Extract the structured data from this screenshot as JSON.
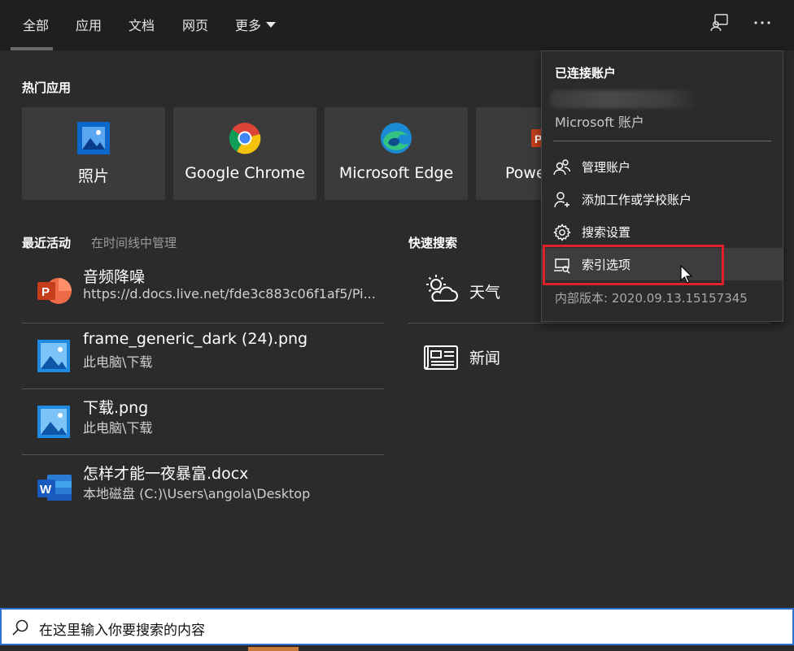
{
  "nav": {
    "tabs": [
      "全部",
      "应用",
      "文档",
      "网页",
      "更多"
    ],
    "active_tab": "全部"
  },
  "top_apps": {
    "title": "热门应用",
    "apps": [
      {
        "label": "照片",
        "icon": "photos-icon"
      },
      {
        "label": "Google Chrome",
        "icon": "chrome-icon"
      },
      {
        "label": "Microsoft Edge",
        "icon": "edge-icon"
      },
      {
        "label": "Powe",
        "icon": "powerpoint-icon"
      }
    ]
  },
  "recent": {
    "title": "最近活动",
    "manage_link": "在时间线中管理",
    "items": [
      {
        "title": "音频降噪",
        "subtitle": "https://d.docs.live.net/fde3c883c06f1af5/Pi...",
        "icon": "powerpoint-icon"
      },
      {
        "title": "frame_generic_dark (24).png",
        "subtitle": "此电脑\\下载",
        "icon": "image-file-icon"
      },
      {
        "title": "下载.png",
        "subtitle": "此电脑\\下载",
        "icon": "image-file-icon"
      },
      {
        "title": "怎样才能一夜暴富.docx",
        "subtitle": "本地磁盘 (C:)\\Users\\angola\\Desktop",
        "icon": "word-icon"
      }
    ]
  },
  "quick_search": {
    "title": "快速搜索",
    "items": [
      {
        "label": "天气",
        "icon": "weather-icon"
      },
      {
        "label": "新闻",
        "icon": "news-icon"
      }
    ]
  },
  "menu": {
    "title": "已连接账户",
    "account_type": "Microsoft 账户",
    "items": [
      {
        "label": "管理账户",
        "icon": "manage-accounts-icon"
      },
      {
        "label": "添加工作或学校账户",
        "icon": "add-account-icon"
      },
      {
        "label": "搜索设置",
        "icon": "gear-icon"
      },
      {
        "label": "索引选项",
        "icon": "index-options-icon",
        "hovered": true
      }
    ],
    "version": "内部版本: 2020.09.13.15157345"
  },
  "search": {
    "placeholder": "在这里输入你要搜索的内容"
  },
  "colors": {
    "background": "#2b2b2b",
    "highlight": "#e0202a",
    "search_border": "#2f6fd0"
  }
}
